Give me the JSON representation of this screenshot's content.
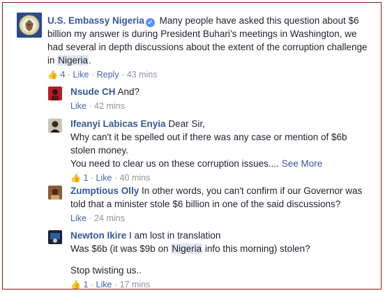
{
  "main": {
    "author": "U.S. Embassy Nigeria",
    "text_before": "Many people have asked this question about $6 billion my answer is during President Buhari’s meetings in Washington, we had several in depth discussions about the extent of the corruption challenge in ",
    "highlight": "Nigeria",
    "text_after": ".",
    "like_count": "4",
    "like_label": "Like",
    "reply_label": "Reply",
    "time": "43 mins",
    "sep": "·"
  },
  "replies": [
    {
      "author": "Nsude CH",
      "text": "And?",
      "like_label": "Like",
      "time": "42 mins",
      "sep": "·"
    },
    {
      "author": "Ifeanyi Labicas Enyia",
      "line1": "Dear Sir,",
      "line2": "Why can't it be spelled out if there was any case or mention of $6b stolen money.",
      "line3": "You need to clear us on these corruption issues....",
      "see_more": "See More",
      "like_count": "1",
      "like_label": "Like",
      "time": "40 mins",
      "sep": "·"
    },
    {
      "author": "Zumptious Olly",
      "text": "In other words, you can't confirm if our Governor was told that a minister stole $6 billion in one of the said discussions?",
      "like_label": "Like",
      "time": "24 mins",
      "sep": "·"
    },
    {
      "author": "Newton Ikire",
      "line1": "I am lost in translation",
      "line2_before": "Was $6b (it was $9b on ",
      "line2_highlight": "Nigeria",
      "line2_after": " info this morning) stolen?",
      "line3": "Stop twisting us..",
      "like_count": "1",
      "like_label": "Like",
      "time": "17 mins",
      "sep": "·"
    }
  ],
  "colors": {
    "link": "#365899",
    "meta": "#90949c",
    "border": "#8b1a1a",
    "highlight": "#e1e6f0"
  }
}
